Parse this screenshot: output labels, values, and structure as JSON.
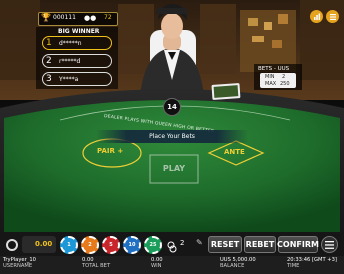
{
  "top_bar": {
    "trophy_icon": "trophy-icon",
    "counter": "000111",
    "players_icon": "players-icon",
    "players_count": "72",
    "right_icons": [
      "chart-icon",
      "menu-icon"
    ]
  },
  "big_winner": {
    "title": "BIG WINNER",
    "rows": [
      {
        "rank": "1",
        "name": "d*****n"
      },
      {
        "rank": "2",
        "name": "r*****d"
      },
      {
        "rank": "3",
        "name": "Y****a"
      }
    ]
  },
  "bets_panel": {
    "title": "BETS - UUS",
    "min_label": "MIN",
    "min_value": "2",
    "max_label": "MAX",
    "max_value": "250"
  },
  "round": {
    "number": "14"
  },
  "table": {
    "arc_text": "DEALER PLAYS WITH QUEEN HIGH OR BETTER",
    "status": "Place Your Bets",
    "pair_plus": "PAIR +",
    "ante": "ANTE",
    "play": "PLAY"
  },
  "controls": {
    "balance_value": "0.00",
    "chips": [
      {
        "value": "1",
        "color": "#1c98d6"
      },
      {
        "value": "2",
        "color": "#e67a1b"
      },
      {
        "value": "5",
        "color": "#c9262b"
      },
      {
        "value": "10",
        "color": "#1f6fc2"
      },
      {
        "value": "25",
        "color": "#1a9d5a"
      }
    ],
    "double_count": "2",
    "reset": "RESET",
    "rebet": "REBET",
    "confirm": "CONFIRM"
  },
  "status_bar": {
    "username_value": "TryPlayer_10",
    "username_label": "USERNAME",
    "total_bet_value": "0.00",
    "total_bet_label": "TOTAL BET",
    "win_value": "0.00",
    "win_label": "WIN",
    "balance_value": "UUS 5,000.00",
    "balance_label": "BALANCE",
    "time_value": "20:33:46 [GMT +3]",
    "time_label": "TIME"
  },
  "colors": {
    "accent": "#f2c21b",
    "felt": "#1e6c2b"
  }
}
